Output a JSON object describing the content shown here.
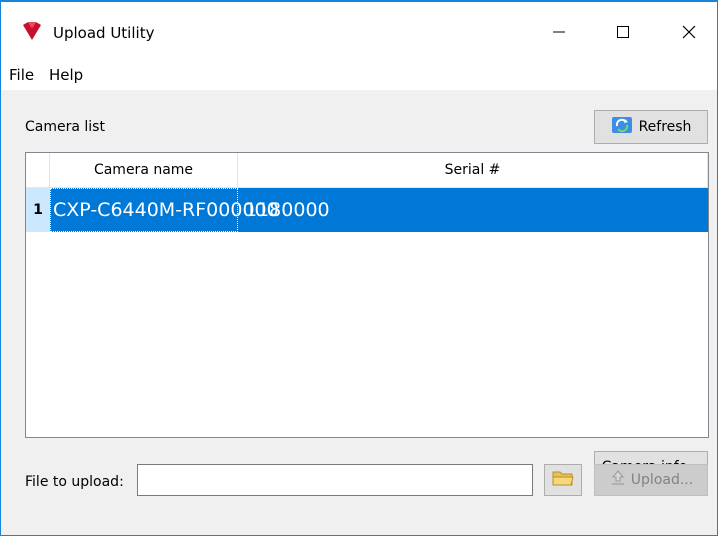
{
  "window": {
    "title": "Upload Utility",
    "controls": {
      "minimize": "—",
      "maximize": "☐",
      "close": "✕"
    }
  },
  "menu": [
    "File",
    "Help"
  ],
  "camera_list": {
    "label": "Camera list",
    "refresh_label": "Refresh",
    "columns": [
      "Camera name",
      "Serial #"
    ],
    "rows": [
      {
        "index": "1",
        "camera_name": "CXP-C6440M-RF000000",
        "serial": "1180000",
        "selected": true
      }
    ]
  },
  "camera_info_label": "Camera info...",
  "upload": {
    "file_label": "File to upload:",
    "file_value": "",
    "upload_label": "Upload..."
  },
  "colors": {
    "accent": "#0078d7",
    "window_border": "#1883d7",
    "app_icon": "#c8102e"
  },
  "icons": {
    "app": "app-logo-icon",
    "refresh": "refresh-icon",
    "browse": "folder-icon",
    "upload": "upload-icon"
  }
}
